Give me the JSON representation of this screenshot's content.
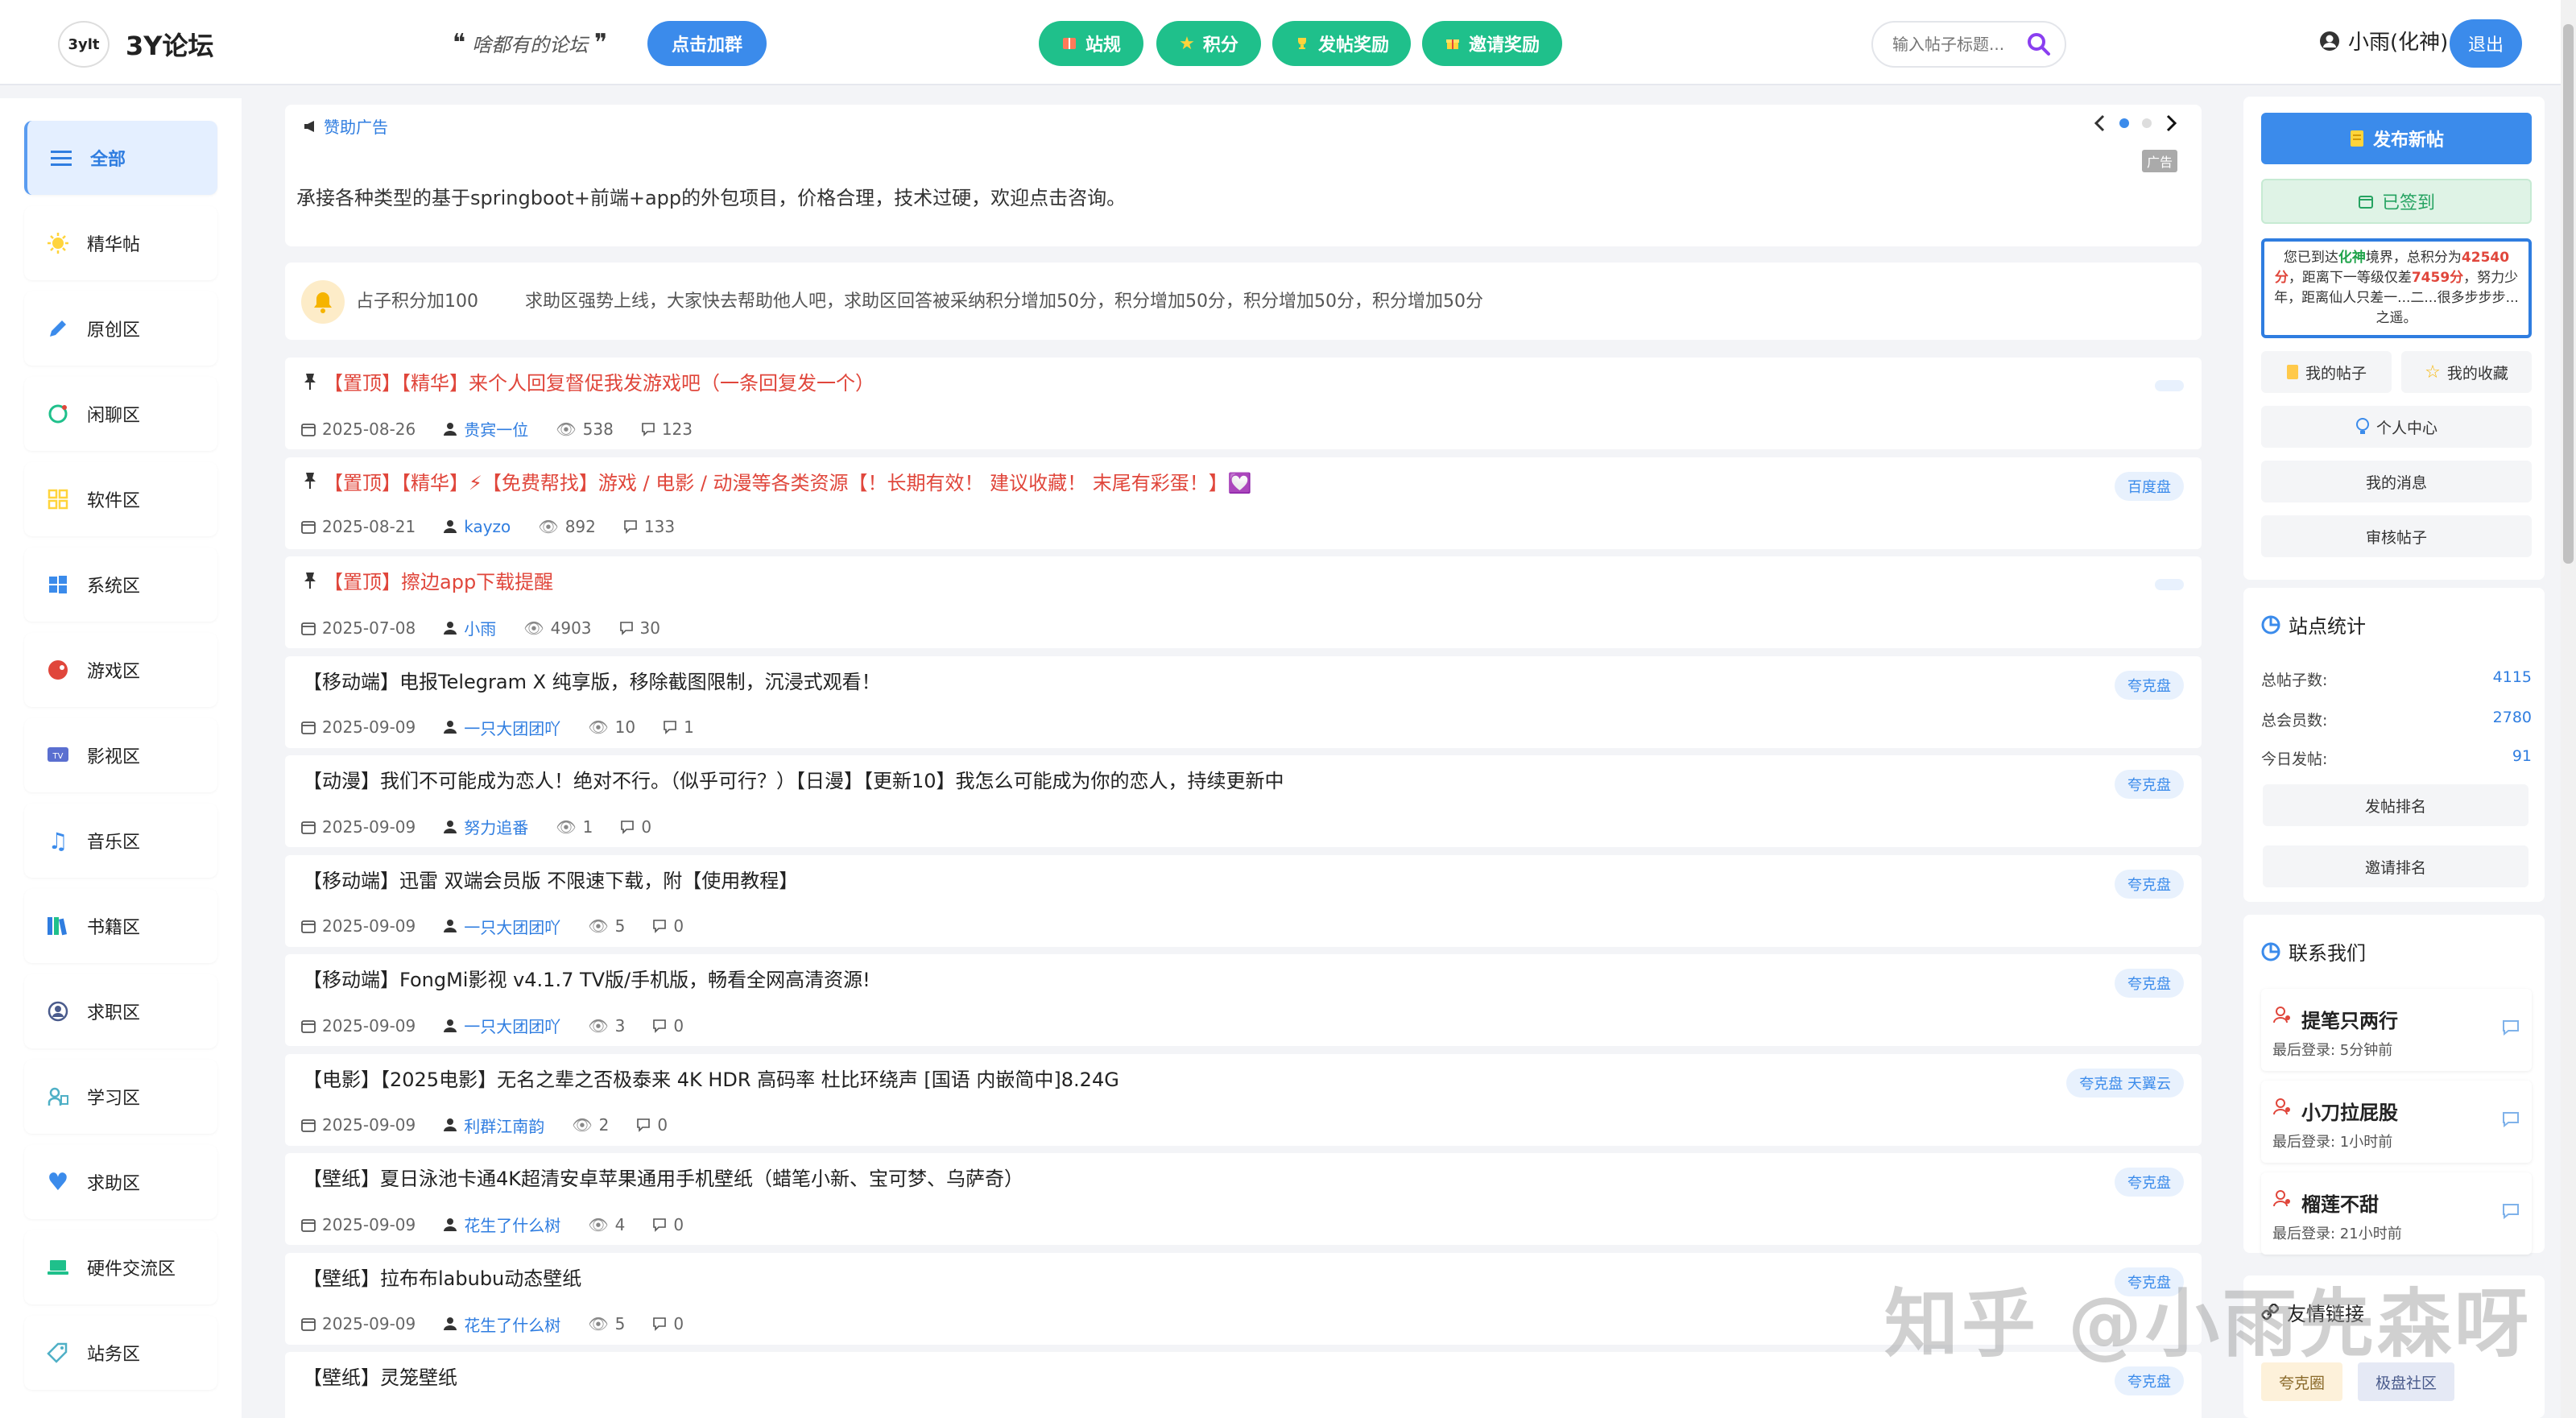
{
  "header": {
    "logo_text": "3ylt",
    "site_name": "3Y论坛",
    "slogan": "啥都有的论坛",
    "join_group": "点击加群",
    "nav": [
      {
        "label": "站规",
        "icon": "book-icon"
      },
      {
        "label": "积分",
        "icon": "star-icon"
      },
      {
        "label": "发帖奖励",
        "icon": "trophy-icon"
      },
      {
        "label": "邀请奖励",
        "icon": "gift-icon"
      }
    ],
    "search_placeholder": "输入帖子标题...",
    "username": "小雨(化神)",
    "logout": "退出"
  },
  "sidebar": {
    "items": [
      {
        "label": "全部",
        "icon": "list-icon",
        "active": true
      },
      {
        "label": "精华帖",
        "icon": "sun-icon"
      },
      {
        "label": "原创区",
        "icon": "pencil-icon"
      },
      {
        "label": "闲聊区",
        "icon": "chat-icon"
      },
      {
        "label": "软件区",
        "icon": "grid-icon"
      },
      {
        "label": "系统区",
        "icon": "windows-icon"
      },
      {
        "label": "游戏区",
        "icon": "gamepad-icon"
      },
      {
        "label": "影视区",
        "icon": "tv-icon"
      },
      {
        "label": "音乐区",
        "icon": "music-icon"
      },
      {
        "label": "书籍区",
        "icon": "books-icon"
      },
      {
        "label": "求职区",
        "icon": "job-icon"
      },
      {
        "label": "学习区",
        "icon": "study-icon"
      },
      {
        "label": "求助区",
        "icon": "heart-icon"
      },
      {
        "label": "硬件交流区",
        "icon": "laptop-icon"
      },
      {
        "label": "站务区",
        "icon": "tag-icon"
      }
    ]
  },
  "ad": {
    "heading": "赞助广告",
    "badge": "广告",
    "text": "承接各种类型的基于springboot+前端+app的外包项目，价格合理，技术过硬，欢迎点击咨询。"
  },
  "notice": {
    "left": "占子积分加100",
    "right": "求助区强势上线，大家快去帮助他人吧，求助区回答被采纳积分增加50分，积分增加50分，积分增加50分，积分增加50分"
  },
  "posts": [
    {
      "title": "【置顶】【精华】来个人回复督促我发游戏吧（一条回复发一个）",
      "pinned": true,
      "hot": true,
      "date": "2025-08-26",
      "author": "贵宾一位",
      "views": "538",
      "replies": "123",
      "tag": ""
    },
    {
      "title": "【置顶】【精华】⚡【免费帮找】游戏 / 电影 / 动漫等各类资源【！长期有效！ 建议收藏！ 末尾有彩蛋！】💟",
      "pinned": true,
      "hot": true,
      "date": "2025-08-21",
      "author": "kayzo",
      "views": "892",
      "replies": "133",
      "tag": "百度盘"
    },
    {
      "title": "【置顶】擦边app下载提醒",
      "pinned": true,
      "hot": true,
      "date": "2025-07-08",
      "author": "小雨",
      "views": "4903",
      "replies": "30",
      "tag": ""
    },
    {
      "title": "【移动端】电报Telegram X 纯享版，移除截图限制，沉浸式观看！",
      "pinned": false,
      "hot": false,
      "date": "2025-09-09",
      "author": "一只大团团吖",
      "views": "10",
      "replies": "1",
      "tag": "夸克盘"
    },
    {
      "title": "【动漫】我们不可能成为恋人！绝对不行。（似乎可行？）【日漫】【更新10】我怎么可能成为你的恋人，持续更新中",
      "pinned": false,
      "hot": false,
      "date": "2025-09-09",
      "author": "努力追番",
      "views": "1",
      "replies": "0",
      "tag": "夸克盘"
    },
    {
      "title": "【移动端】迅雷 双端会员版 不限速下载，附【使用教程】",
      "pinned": false,
      "hot": false,
      "date": "2025-09-09",
      "author": "一只大团团吖",
      "views": "5",
      "replies": "0",
      "tag": "夸克盘"
    },
    {
      "title": "【移动端】FongMi影视 v4.1.7 TV版/手机版，畅看全网高清资源!",
      "pinned": false,
      "hot": false,
      "date": "2025-09-09",
      "author": "一只大团团吖",
      "views": "3",
      "replies": "0",
      "tag": "夸克盘"
    },
    {
      "title": "【电影】【2025电影】无名之辈之否极泰来 4K HDR 高码率 杜比环绕声 [国语 内嵌简中]8.24G",
      "pinned": false,
      "hot": false,
      "date": "2025-09-09",
      "author": "利群江南韵",
      "views": "2",
      "replies": "0",
      "tag": "夸克盘 天翼云"
    },
    {
      "title": "【壁纸】夏日泳池卡通4K超清安卓苹果通用手机壁纸（蜡笔小新、宝可梦、乌萨奇）",
      "pinned": false,
      "hot": false,
      "date": "2025-09-09",
      "author": "花生了什么树",
      "views": "4",
      "replies": "0",
      "tag": "夸克盘"
    },
    {
      "title": "【壁纸】拉布布labubu动态壁纸",
      "pinned": false,
      "hot": false,
      "date": "2025-09-09",
      "author": "花生了什么树",
      "views": "5",
      "replies": "0",
      "tag": "夸克盘"
    },
    {
      "title": "【壁纸】灵笼壁纸",
      "pinned": false,
      "hot": false,
      "date": "",
      "author": "",
      "views": "",
      "replies": "",
      "tag": "夸克盘"
    }
  ],
  "right": {
    "new_post": "发布新帖",
    "signed": "已签到",
    "realm": {
      "p1": "您已到达",
      "level": "化神",
      "p2": "境界，总积分为",
      "score": "42540分",
      "p3": "，距离下一等级仅差",
      "gap": "7459分",
      "p4": "，努力少年，距离仙人只差一...二...很多步步步...之遥。"
    },
    "my_posts": "我的帖子",
    "my_favs": "我的收藏",
    "profile": "个人中心",
    "messages": "我的消息",
    "review": "审核帖子",
    "stats": {
      "title": "站点统计",
      "rows": [
        {
          "label": "总帖子数:",
          "value": "4115"
        },
        {
          "label": "总会员数:",
          "value": "2780"
        },
        {
          "label": "今日发帖:",
          "value": "91"
        }
      ],
      "post_rank": "发帖排名",
      "invite_rank": "邀请排名"
    },
    "contact": {
      "title": "联系我们",
      "people": [
        {
          "name": "提笔只两行",
          "login": "最后登录: 5分钟前"
        },
        {
          "name": "小刀拉屁股",
          "login": "最后登录: 1小时前"
        },
        {
          "name": "榴莲不甜",
          "login": "最后登录: 21小时前"
        }
      ]
    },
    "friends": {
      "title": "友情链接",
      "items": [
        "夸克圈",
        "极盘社区"
      ]
    }
  },
  "watermark": "知乎 @小雨先森呀",
  "colors": {
    "accent": "#3b8beb",
    "green": "#1fc08b",
    "hot": "#e0463b"
  }
}
